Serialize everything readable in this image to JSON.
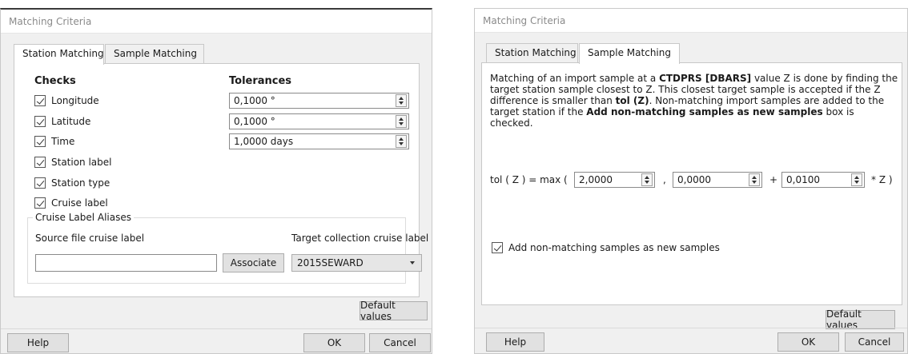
{
  "dialogs": [
    {
      "title": "Matching Criteria",
      "tabs": [
        "Station Matching",
        "Sample Matching"
      ],
      "checks_header": "Checks",
      "tolerances_header": "Tolerances",
      "checks": [
        {
          "label": "Longitude",
          "checked": true
        },
        {
          "label": "Latitude",
          "checked": true
        },
        {
          "label": "Time",
          "checked": true
        },
        {
          "label": "Station label",
          "checked": true
        },
        {
          "label": "Station type",
          "checked": true
        },
        {
          "label": "Cruise label",
          "checked": true
        }
      ],
      "tolerances": [
        "0,1000 °",
        "0,1000 °",
        "1,0000 days"
      ],
      "aliases": {
        "title": "Cruise Label Aliases",
        "source_label": "Source file cruise label",
        "source_value": "",
        "associate": "Associate",
        "target_label": "Target collection cruise label",
        "target_value": "2015SEWARD"
      },
      "default_values": "Default values",
      "help": "Help",
      "ok": "OK",
      "cancel": "Cancel"
    },
    {
      "title": "Matching Criteria",
      "tabs": [
        "Station Matching",
        "Sample Matching"
      ],
      "description": {
        "p1": "Matching of an import sample at a ",
        "b1": "CTDPRS [DBARS]",
        "p2": " value Z is done by finding the target station sample closest to Z. This closest target sample is accepted if the Z difference is smaller than ",
        "b2": "tol (Z)",
        "p3": ". Non-matching import samples are added to the target station if the ",
        "b3": "Add non-matching samples as new samples",
        "p4": " box is checked."
      },
      "formula": {
        "prefix": "tol ( Z ) = max (",
        "v1": "2,0000",
        "comma": ",",
        "v2": "0,0000",
        "plus": "+",
        "v3": "0,0100",
        "suffix": "* Z )"
      },
      "add_nonmatching": {
        "label": "Add non-matching samples as new samples",
        "checked": true
      },
      "default_values": "Default values",
      "help": "Help",
      "ok": "OK",
      "cancel": "Cancel"
    }
  ]
}
